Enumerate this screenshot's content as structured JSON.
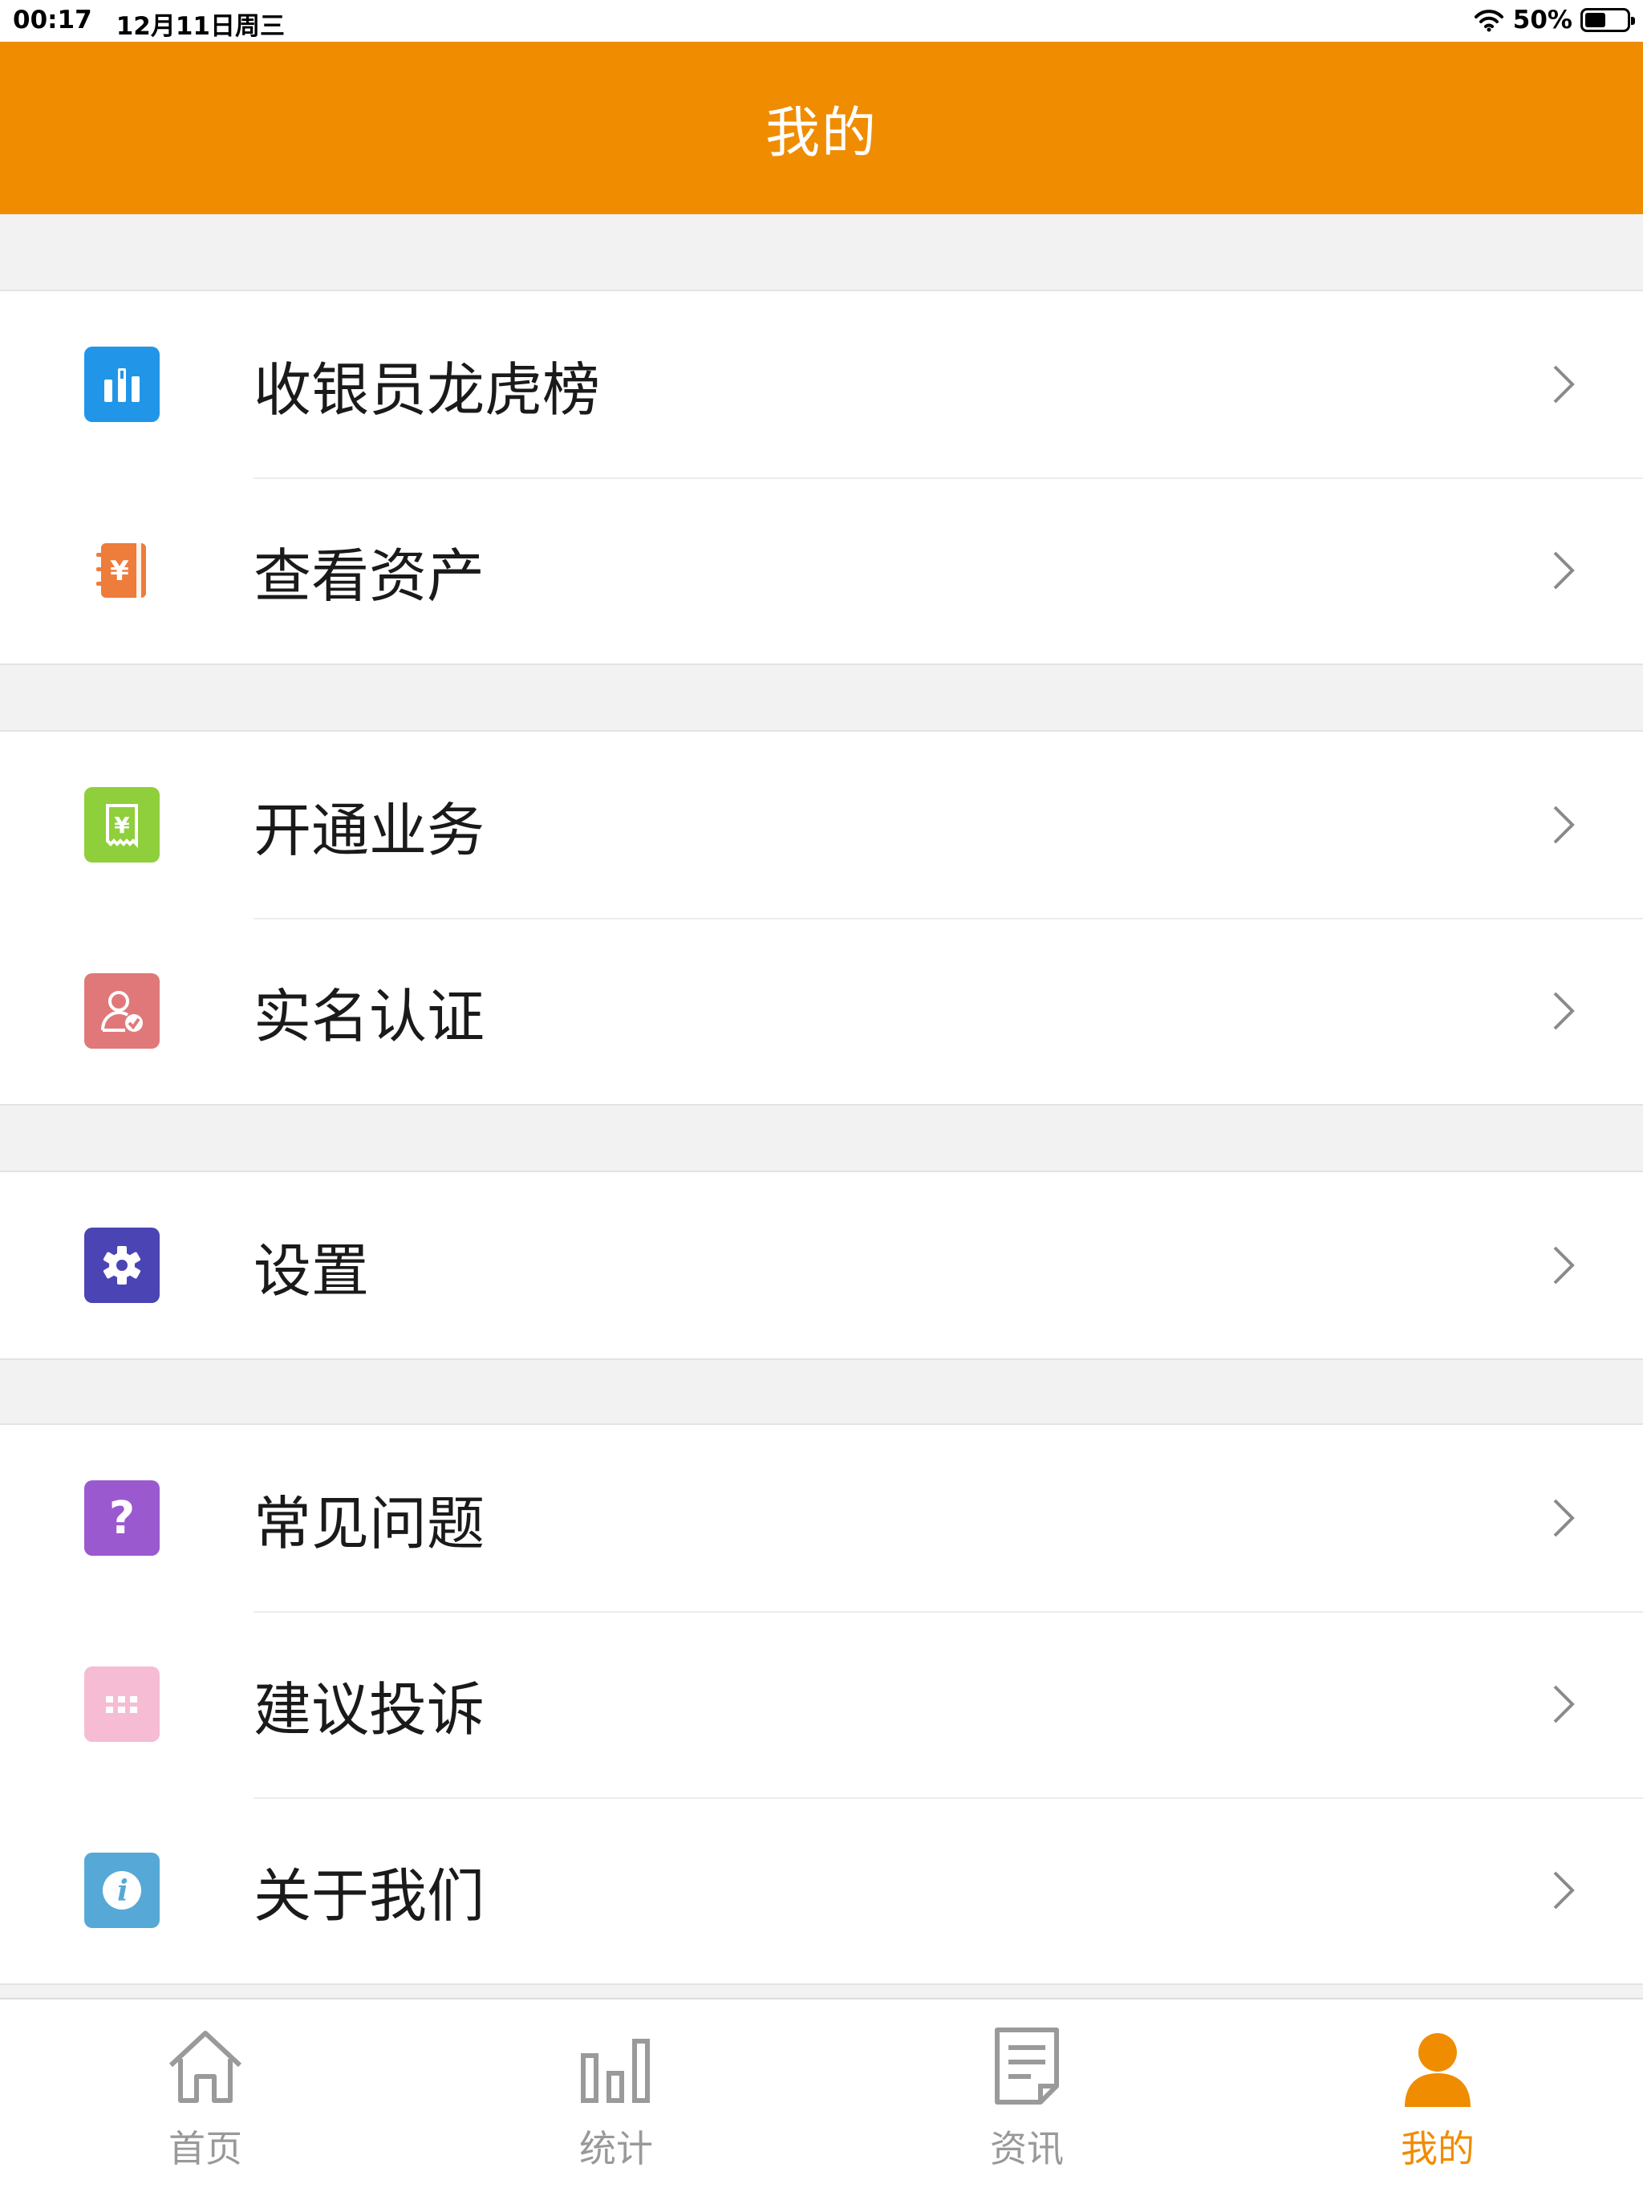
{
  "status_bar": {
    "time": "00:17",
    "date": "12月11日周三",
    "battery": "50%",
    "battery_level": 0.5
  },
  "header": {
    "title": "我的"
  },
  "menu_groups": [
    {
      "items": [
        {
          "label": "收银员龙虎榜",
          "icon": "bar-chart-icon",
          "color": "#2196e8"
        },
        {
          "label": "查看资产",
          "icon": "yuan-notebook-icon",
          "color": "#ee7c3b"
        }
      ]
    },
    {
      "items": [
        {
          "label": "开通业务",
          "icon": "yuan-receipt-icon",
          "color": "#8fcf3b"
        },
        {
          "label": "实名认证",
          "icon": "user-check-icon",
          "color": "#e0787a"
        }
      ]
    },
    {
      "items": [
        {
          "label": "设置",
          "icon": "gear-icon",
          "color": "#4b44b4"
        }
      ]
    },
    {
      "items": [
        {
          "label": "常见问题",
          "icon": "question-icon",
          "color": "#9b59d0"
        },
        {
          "label": "建议投诉",
          "icon": "keypad-icon",
          "color": "#f6bcd3"
        },
        {
          "label": "关于我们",
          "icon": "info-icon",
          "color": "#56a9d6"
        }
      ]
    }
  ],
  "tabbar": {
    "active_color": "#f08c00",
    "inactive_color": "#999999",
    "tabs": [
      {
        "label": "首页",
        "icon": "home-icon",
        "active": false
      },
      {
        "label": "统计",
        "icon": "stats-icon",
        "active": false
      },
      {
        "label": "资讯",
        "icon": "news-icon",
        "active": false
      },
      {
        "label": "我的",
        "icon": "person-icon",
        "active": true
      }
    ]
  }
}
